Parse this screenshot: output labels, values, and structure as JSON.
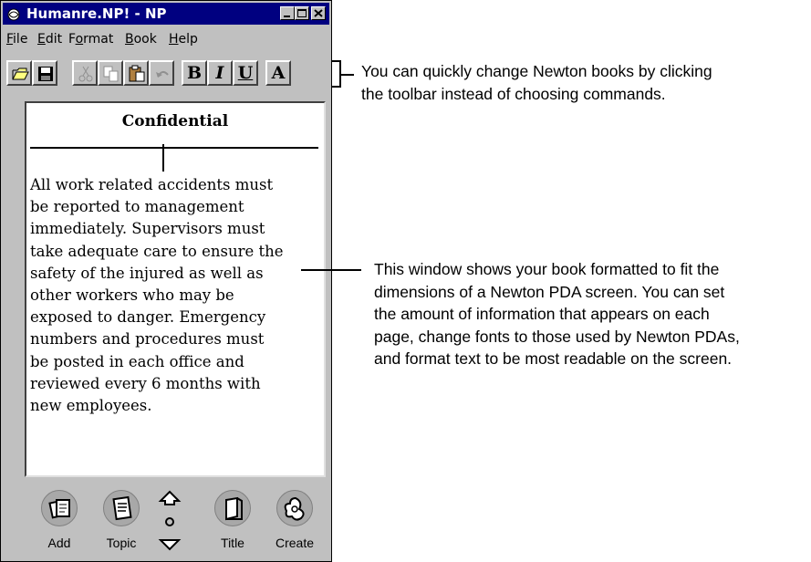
{
  "window": {
    "title": "Humanre.NP! - NP",
    "controls": [
      "minimize-icon",
      "maximize-icon",
      "close-icon"
    ]
  },
  "menubar": {
    "items": [
      {
        "label": "File",
        "underline": "F"
      },
      {
        "label": "Edit",
        "underline": "E"
      },
      {
        "label": "Format",
        "underline": "o"
      },
      {
        "label": "Book",
        "underline": "B"
      },
      {
        "label": "Help",
        "underline": "H"
      }
    ]
  },
  "toolbar": {
    "buttons": [
      {
        "icon": "open-folder-icon",
        "enabled": true
      },
      {
        "icon": "save-disk-icon",
        "enabled": true
      },
      {
        "icon": "cut-scissors-icon",
        "enabled": false
      },
      {
        "icon": "copy-icon",
        "enabled": false
      },
      {
        "icon": "paste-clipboard-icon",
        "enabled": true
      },
      {
        "icon": "undo-icon",
        "enabled": false
      },
      {
        "label": "B",
        "icon": "bold-icon",
        "pressed": false
      },
      {
        "label": "I",
        "icon": "italic-icon",
        "pressed": false
      },
      {
        "label": "U",
        "icon": "underline-icon",
        "pressed": false
      },
      {
        "label": "A",
        "icon": "font-icon",
        "pressed": false
      }
    ]
  },
  "page": {
    "title": "Confidential",
    "body": "All work related accidents must\nbe reported to management\nimmediately. Supervisors must\ntake adequate care to ensure the\nsafety of the injured as well as\nother workers who may be\nexposed to danger. Emergency\nnumbers and procedures must\nbe posted in each office and\nreviewed every 6 months with\nnew employees."
  },
  "nav": {
    "add_label": "Add",
    "topic_label": "Topic",
    "title_label": "Title",
    "create_label": "Create",
    "scroll_icons": [
      "scroll-up-arrow-icon",
      "scroll-dot-icon",
      "scroll-down-arrow-icon"
    ]
  },
  "annotations": {
    "toolbar_note": "You can quickly change Newton books by clicking\nthe toolbar instead of choosing commands.",
    "window_note": "This window shows your book formatted to fit the\ndimensions of a Newton PDA screen. You can set\nthe amount of information that appears on each\npage, change fonts to those used by Newton PDAs,\nand format text to be most readable on the screen."
  }
}
